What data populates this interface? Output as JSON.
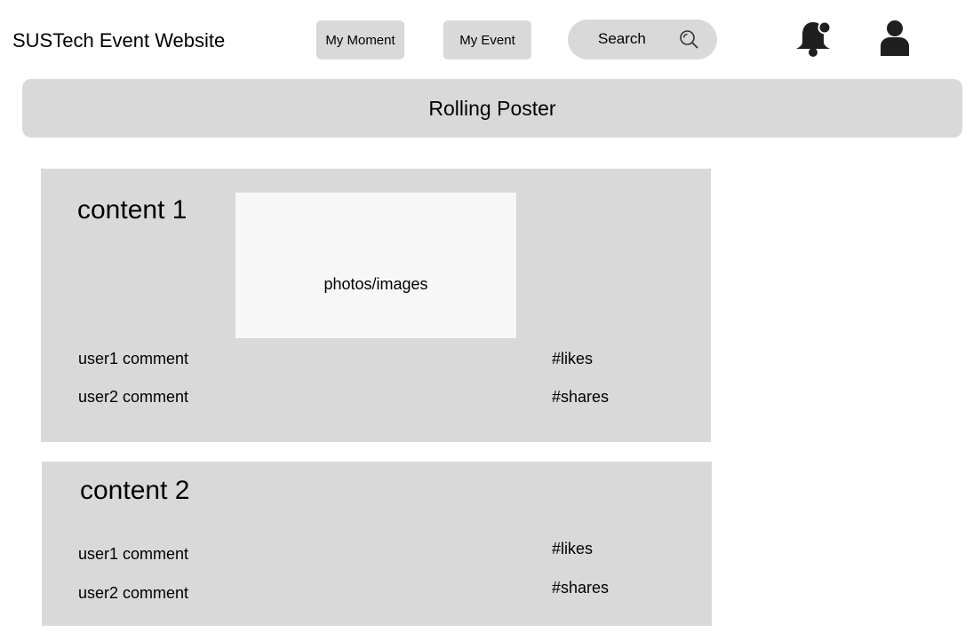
{
  "header": {
    "site_title": "SUSTech Event Website",
    "nav": {
      "my_moment": "My Moment",
      "my_event": "My Event"
    },
    "search": {
      "label": "Search",
      "icon": "search-icon"
    },
    "icons": {
      "notifications": "bell-icon",
      "profile": "user-icon"
    }
  },
  "poster": {
    "label": "Rolling Poster"
  },
  "feed": {
    "items": [
      {
        "title": "content 1",
        "media_label": "photos/images",
        "comments": [
          "user1 comment",
          "user2 comment"
        ],
        "likes_label": "#likes",
        "shares_label": "#shares"
      },
      {
        "title": "content 2",
        "comments": [
          "user1 comment",
          "user2 comment"
        ],
        "likes_label": "#likes",
        "shares_label": "#shares"
      }
    ]
  },
  "colors": {
    "panel_gray": "#d9d9d9",
    "photo_bg": "#f7f7f7",
    "icon_dark": "#1f1f1f"
  }
}
